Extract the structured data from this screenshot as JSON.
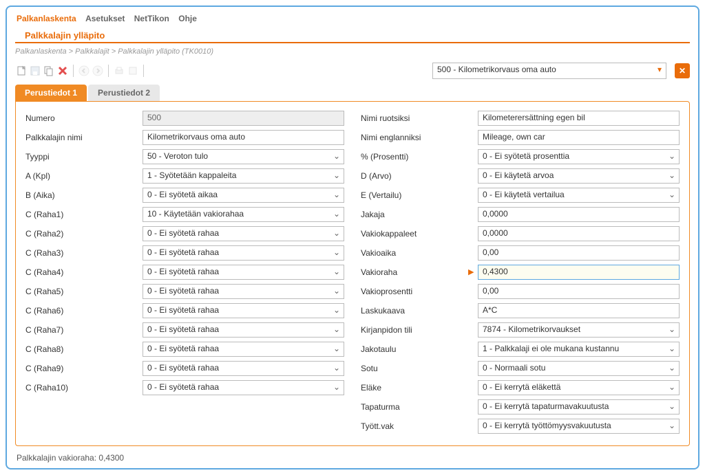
{
  "menu": {
    "items": [
      "Palkanlaskenta",
      "Asetukset",
      "NetTikon",
      "Ohje"
    ],
    "activeIndex": 0
  },
  "pageTitle": "Palkkalajin ylläpito",
  "breadcrumb": "Palkanlaskenta > Palkkalajit > Palkkalajin ylläpito  (TK0010)",
  "headerSelect": "500 - Kilometrikorvaus oma auto",
  "tabs": {
    "items": [
      "Perustiedot 1",
      "Perustiedot 2"
    ],
    "activeIndex": 0
  },
  "left": {
    "numero": {
      "label": "Numero",
      "value": "500"
    },
    "nimi": {
      "label": "Palkkalajin nimi",
      "value": "Kilometrikorvaus oma auto"
    },
    "tyyppi": {
      "label": "Tyyppi",
      "value": "50 - Veroton tulo"
    },
    "a": {
      "label": "A (Kpl)",
      "value": "1 - Syötetään kappaleita"
    },
    "b": {
      "label": "B (Aika)",
      "value": "0 - Ei syötetä aikaa"
    },
    "c1": {
      "label": "C (Raha1)",
      "value": "10 - Käytetään vakiorahaa"
    },
    "c2": {
      "label": "C (Raha2)",
      "value": "0 - Ei syötetä rahaa"
    },
    "c3": {
      "label": "C (Raha3)",
      "value": "0 - Ei syötetä rahaa"
    },
    "c4": {
      "label": "C (Raha4)",
      "value": "0 - Ei syötetä rahaa"
    },
    "c5": {
      "label": "C (Raha5)",
      "value": "0 - Ei syötetä rahaa"
    },
    "c6": {
      "label": "C (Raha6)",
      "value": "0 - Ei syötetä rahaa"
    },
    "c7": {
      "label": "C (Raha7)",
      "value": "0 - Ei syötetä rahaa"
    },
    "c8": {
      "label": "C (Raha8)",
      "value": "0 - Ei syötetä rahaa"
    },
    "c9": {
      "label": "C (Raha9)",
      "value": "0 - Ei syötetä rahaa"
    },
    "c10": {
      "label": "C (Raha10)",
      "value": "0 - Ei syötetä rahaa"
    }
  },
  "right": {
    "nimiRu": {
      "label": "Nimi ruotsiksi",
      "value": "Kilometerersättning egen bil"
    },
    "nimiEn": {
      "label": "Nimi englanniksi",
      "value": "Mileage, own car"
    },
    "prosentti": {
      "label": "% (Prosentti)",
      "value": "0 - Ei syötetä prosenttia"
    },
    "d": {
      "label": "D (Arvo)",
      "value": "0 - Ei käytetä arvoa"
    },
    "e": {
      "label": "E (Vertailu)",
      "value": "0 - Ei käytetä vertailua"
    },
    "jakaja": {
      "label": "Jakaja",
      "value": "0,0000"
    },
    "vakiokpl": {
      "label": "Vakiokappaleet",
      "value": "0,0000"
    },
    "vakioaika": {
      "label": "Vakioaika",
      "value": "0,00"
    },
    "vakioraha": {
      "label": "Vakioraha",
      "value": "0,4300"
    },
    "vakiopros": {
      "label": "Vakioprosentti",
      "value": "0,00"
    },
    "laskukaava": {
      "label": "Laskukaava",
      "value": "A*C"
    },
    "tili": {
      "label": "Kirjanpidon tili",
      "value": "7874 - Kilometrikorvaukset"
    },
    "jakotaulu": {
      "label": "Jakotaulu",
      "value": "1 - Palkkalaji ei ole mukana kustannu"
    },
    "sotu": {
      "label": "Sotu",
      "value": "0 - Normaali sotu"
    },
    "elake": {
      "label": "Eläke",
      "value": "0 - Ei kerrytä eläkettä"
    },
    "tapaturma": {
      "label": "Tapaturma",
      "value": "0 - Ei kerrytä tapaturmavakuutusta"
    },
    "tyottvak": {
      "label": "Tyött.vak",
      "value": "0 - Ei kerrytä työttömyysvakuutusta"
    }
  },
  "statusBar": "Palkkalajin vakioraha: 0,4300"
}
